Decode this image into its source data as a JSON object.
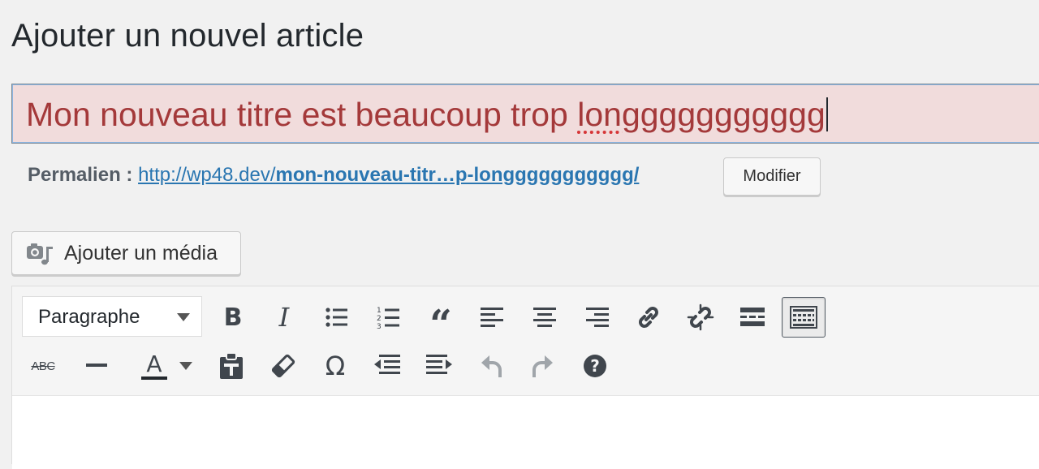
{
  "page": {
    "title": "Ajouter un nouvel article"
  },
  "title_field": {
    "value_prefix": "Mon nouveau titre est beaucoup trop ",
    "value_misspelled": "longgggggggggg",
    "state": "error",
    "bg_color": "#f1dcdc",
    "text_color": "#a4393a"
  },
  "permalink": {
    "label": "Permalien :",
    "url_base": "http://wp48.dev/",
    "url_slug": "mon-nouveau-titr…p-longgggggggggg/",
    "edit_label": "Modifier",
    "link_color": "#2a76b1"
  },
  "media_button": {
    "label": "Ajouter un média",
    "icon": "media-icon"
  },
  "editor": {
    "format_select": {
      "selected": "Paragraphe"
    },
    "toolbar_row1": [
      "bold-icon",
      "italic-icon",
      "bullet-list-icon",
      "numbered-list-icon",
      "blockquote-icon",
      "align-left-icon",
      "align-center-icon",
      "align-right-icon",
      "link-icon",
      "unlink-icon",
      "read-more-icon",
      "toolbar-toggle-icon"
    ],
    "toolbar_row2": [
      "strikethrough-icon",
      "horizontal-line-icon",
      "text-color-icon",
      "paste-text-icon",
      "clear-formatting-icon",
      "special-character-icon",
      "outdent-icon",
      "indent-icon",
      "undo-icon",
      "redo-icon",
      "help-icon"
    ],
    "glyphs": {
      "bold": "B",
      "italic": "I",
      "strike": "ABC",
      "color": "A",
      "omega": "Ω",
      "quote": "“",
      "help": "?"
    }
  }
}
